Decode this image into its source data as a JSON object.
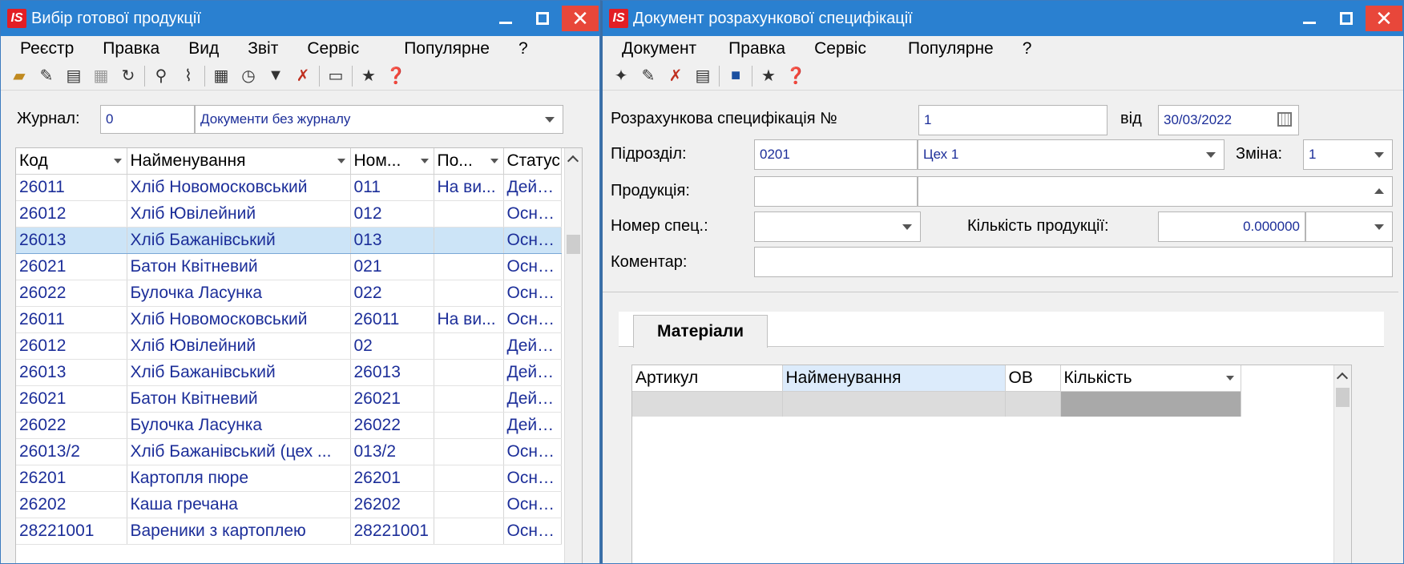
{
  "window_a": {
    "title": "Вибір готової продукції",
    "menu": [
      "Реєстр",
      "Правка",
      "Вид",
      "Звіт",
      "Сервіс",
      "Популярне",
      "?"
    ],
    "journal_label": "Журнал:",
    "journal_code": "0",
    "journal_name": "Документи без журналу",
    "columns": [
      "Код",
      "Найменування",
      "Ном...",
      "По...",
      "Статус"
    ],
    "rows": [
      {
        "code": "26011",
        "name": "Хліб Новомосковський",
        "num": "011",
        "po": "На ви...",
        "status": "Действ"
      },
      {
        "code": "26012",
        "name": "Хліб Ювілейний",
        "num": "012",
        "po": "",
        "status": "Основн"
      },
      {
        "code": "26013",
        "name": "Хліб Бажанівський",
        "num": "013",
        "po": "",
        "status": "Основн"
      },
      {
        "code": "26021",
        "name": "Батон Квітневий",
        "num": "021",
        "po": "",
        "status": "Основн"
      },
      {
        "code": "26022",
        "name": "Булочка Ласунка",
        "num": "022",
        "po": "",
        "status": "Основн"
      },
      {
        "code": "26011",
        "name": "Хліб Новомосковський",
        "num": "26011",
        "po": "На ви...",
        "status": "Основн"
      },
      {
        "code": "26012",
        "name": "Хліб Ювілейний",
        "num": "02",
        "po": "",
        "status": "Действ"
      },
      {
        "code": "26013",
        "name": "Хліб Бажанівський",
        "num": "26013",
        "po": "",
        "status": "Действ"
      },
      {
        "code": "26021",
        "name": "Батон Квітневий",
        "num": "26021",
        "po": "",
        "status": "Действ"
      },
      {
        "code": "26022",
        "name": "Булочка Ласунка",
        "num": "26022",
        "po": "",
        "status": "Действ"
      },
      {
        "code": "26013/2",
        "name": "Хліб Бажанівський (цех ...",
        "num": "013/2",
        "po": "",
        "status": "Основн"
      },
      {
        "code": "26201",
        "name": "Картопля пюре",
        "num": "26201",
        "po": "",
        "status": "Основн"
      },
      {
        "code": "26202",
        "name": "Каша гречана",
        "num": "26202",
        "po": "",
        "status": "Основн"
      },
      {
        "code": "28221001",
        "name": "Вареники з картоплею",
        "num": "28221001",
        "po": "",
        "status": "Основн"
      }
    ],
    "selected_row": 2
  },
  "window_b": {
    "title": "Документ розрахункової специфікації",
    "menu": [
      "Документ",
      "Правка",
      "Сервіс",
      "Популярне",
      "?"
    ],
    "spec_label": "Розрахункова специфікація №",
    "spec_number": "1",
    "date_label": "від",
    "date_value": "30/03/2022",
    "subdivision_label": "Підрозділ:",
    "subdivision_code": "0201",
    "subdivision_name": "Цех 1",
    "shift_label": "Зміна:",
    "shift_value": "1",
    "product_label": "Продукція:",
    "product_code": "",
    "product_name": "",
    "spec_num_label": "Номер спец.:",
    "spec_num_value": "",
    "qty_label": "Кількість продукції:",
    "qty_value": "0.000000",
    "qty_unit": "",
    "comment_label": "Коментар:",
    "comment_value": "",
    "tab_label": "Матеріали",
    "columns": [
      "Артикул",
      "Найменування",
      "ОВ",
      "Кількість"
    ]
  }
}
